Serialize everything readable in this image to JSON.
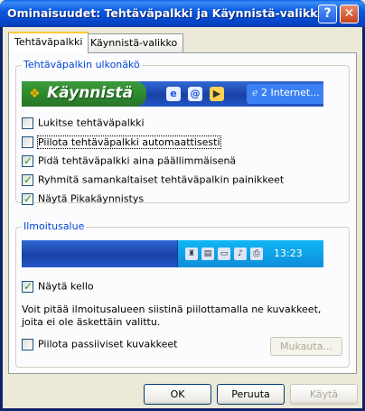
{
  "window": {
    "title": "Ominaisuudet: Tehtäväpalkki ja Käynnistä-valikko"
  },
  "titlebar_buttons": {
    "help": "?",
    "close": "✕"
  },
  "tabs": [
    {
      "label": "Tehtäväpalkki",
      "active": true
    },
    {
      "label": "Käynnistä-valikko",
      "active": false
    }
  ],
  "appearance_group": {
    "label": "Tehtäväpalkin ulkonäkö",
    "preview": {
      "start_label": "Käynnistä",
      "task_button": "2 Internet..."
    },
    "options": [
      {
        "label": "Lukitse tehtäväpalkki",
        "checked": false
      },
      {
        "label": "Piilota tehtäväpalkki automaattisesti",
        "checked": false
      },
      {
        "label": "Pidä tehtäväpalkki aina päällimmäisenä",
        "checked": true
      },
      {
        "label": "Ryhmitä samankaltaiset tehtäväpalkin painikkeet",
        "checked": true
      },
      {
        "label": "Näytä Pikakäynnistys",
        "checked": true
      }
    ]
  },
  "notification_group": {
    "label": "Ilmoitusalue",
    "clock_preview": "13:23",
    "show_clock": {
      "label": "Näytä kello",
      "checked": true
    },
    "description": "Voit pitää ilmoitusalueen siistinä piilottamalla ne kuvakkeet, joita ei ole äskettäin valittu.",
    "hide_inactive": {
      "label": "Piilota passiiviset kuvakkeet",
      "checked": false
    },
    "customize_label": "Mukauta..."
  },
  "buttons": {
    "ok": "OK",
    "cancel": "Peruuta",
    "apply": "Käytä"
  },
  "colors": {
    "title_blue": "#0a5fe3",
    "group_label": "#0046d5",
    "checkmark": "#21a121",
    "start_green": "#2f8a2f"
  }
}
